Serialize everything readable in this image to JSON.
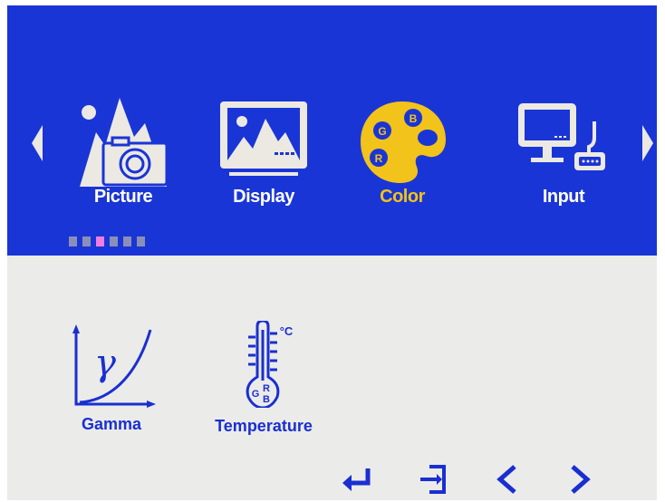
{
  "main_menu": {
    "items": [
      {
        "label": "Picture",
        "icon": "picture-icon",
        "selected": false
      },
      {
        "label": "Display",
        "icon": "display-icon",
        "selected": false
      },
      {
        "label": "Color",
        "icon": "palette-icon",
        "selected": true
      },
      {
        "label": "Input",
        "icon": "input-icon",
        "selected": false
      }
    ],
    "page_dots": 6,
    "active_dot": 2
  },
  "color_submenu": {
    "items": [
      {
        "label": "Gamma",
        "icon": "gamma-icon",
        "symbol": "γ"
      },
      {
        "label": "Temperature",
        "icon": "thermometer-icon",
        "unit": "°C",
        "rgb": [
          "G",
          "R",
          "B"
        ]
      }
    ]
  },
  "controls": [
    "enter-icon",
    "exit-icon",
    "left-arrow-icon",
    "right-arrow-icon"
  ],
  "colors": {
    "header_bg": "#1a35d6",
    "panel_bg": "#ebebea",
    "menu_text": "#ffffff",
    "selected_text": "#f2c31a",
    "icon_fill": "#ece9e2",
    "submenu_blue": "#1a2fd0",
    "dot_inactive": "#8a8fb8",
    "dot_active": "#f07ee0"
  }
}
